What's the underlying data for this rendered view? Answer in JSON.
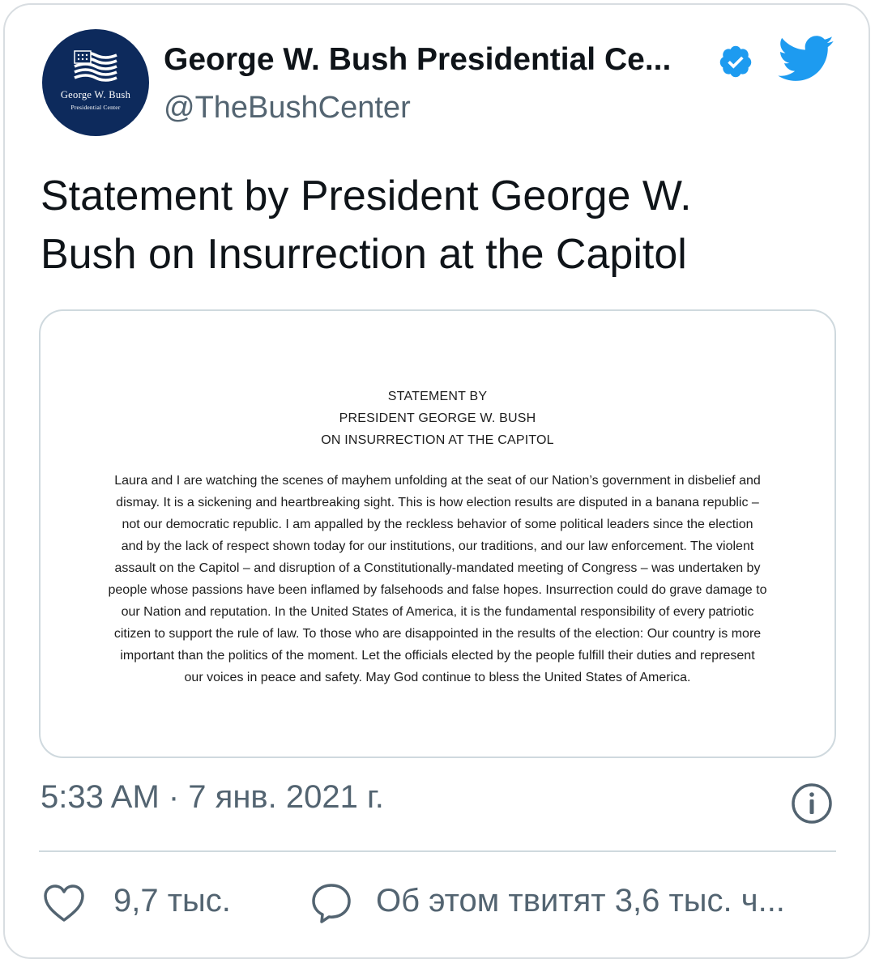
{
  "account": {
    "display_name": "George W. Bush Presidential Ce...",
    "handle": "@TheBushCenter",
    "avatar_line1": "George W. Bush",
    "avatar_line2": "Presidential Center",
    "avatar_color": "#0d2a5c",
    "verified_icon": "verified-badge-icon",
    "platform_icon": "twitter-bird-icon"
  },
  "tweet": {
    "text": "Statement by President George W. Bush on Insurrection at the Capitol",
    "text_lines": [
      "Statement by President George W.",
      "Bush on Insurrection at the Capitol"
    ]
  },
  "document": {
    "heading": [
      "STATEMENT BY",
      "PRESIDENT GEORGE W. BUSH",
      "ON INSURRECTION AT THE CAPITOL"
    ],
    "body_lines": [
      "Laura and I are watching the scenes of mayhem unfolding at the seat of our Nation’s government in disbelief and",
      "dismay. It is a sickening and heartbreaking sight. This is how election results are disputed in a banana republic –",
      "not our democratic republic. I am appalled by the reckless behavior of some political leaders since the election",
      "and by the lack of respect shown today for our institutions, our traditions, and our law enforcement. The violent",
      "assault on the Capitol – and disruption of a Constitutionally-mandated meeting of Congress – was undertaken by",
      "people whose passions have been inflamed by falsehoods and false hopes. Insurrection could do grave damage to",
      "our Nation and reputation. In the United States of America, it is the fundamental responsibility of every patriotic",
      "citizen to support the rule of law. To those who are disappointed in the results of the election: Our country is more",
      "important than the politics of the moment. Let the officials elected by the people fulfill their duties and represent",
      "our voices in peace and safety. May God continue to bless the United States of America."
    ]
  },
  "meta": {
    "timestamp": "5:33 AM · 7 янв. 2021 г.",
    "info_icon": "info-icon"
  },
  "actions": {
    "like_count": "9,7 тыс.",
    "discuss_label": "Об этом твитят 3,6 тыс. ч...",
    "like_icon": "heart-icon",
    "reply_icon": "speech-bubble-icon"
  },
  "colors": {
    "twitter_blue": "#1d9bf0",
    "secondary_text": "#536471",
    "border": "#cfd9de"
  }
}
